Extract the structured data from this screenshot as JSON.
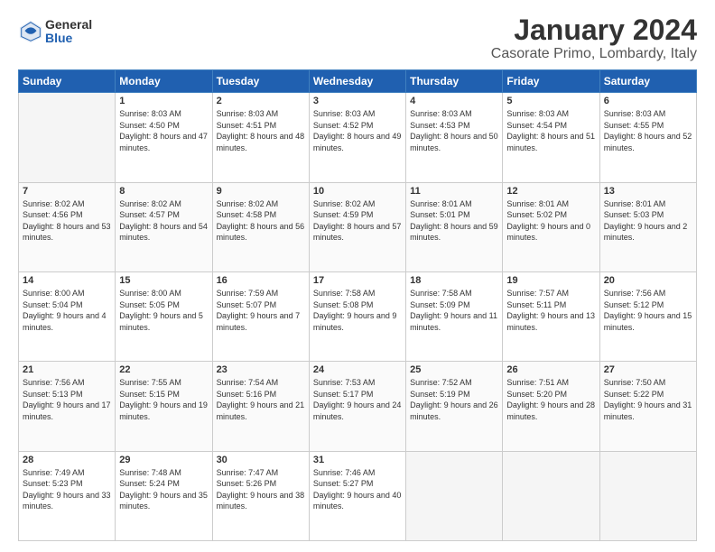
{
  "logo": {
    "general": "General",
    "blue": "Blue"
  },
  "title": "January 2024",
  "subtitle": "Casorate Primo, Lombardy, Italy",
  "headers": [
    "Sunday",
    "Monday",
    "Tuesday",
    "Wednesday",
    "Thursday",
    "Friday",
    "Saturday"
  ],
  "weeks": [
    [
      {
        "day": "",
        "empty": true
      },
      {
        "day": "1",
        "sunrise": "Sunrise: 8:03 AM",
        "sunset": "Sunset: 4:50 PM",
        "daylight": "Daylight: 8 hours and 47 minutes."
      },
      {
        "day": "2",
        "sunrise": "Sunrise: 8:03 AM",
        "sunset": "Sunset: 4:51 PM",
        "daylight": "Daylight: 8 hours and 48 minutes."
      },
      {
        "day": "3",
        "sunrise": "Sunrise: 8:03 AM",
        "sunset": "Sunset: 4:52 PM",
        "daylight": "Daylight: 8 hours and 49 minutes."
      },
      {
        "day": "4",
        "sunrise": "Sunrise: 8:03 AM",
        "sunset": "Sunset: 4:53 PM",
        "daylight": "Daylight: 8 hours and 50 minutes."
      },
      {
        "day": "5",
        "sunrise": "Sunrise: 8:03 AM",
        "sunset": "Sunset: 4:54 PM",
        "daylight": "Daylight: 8 hours and 51 minutes."
      },
      {
        "day": "6",
        "sunrise": "Sunrise: 8:03 AM",
        "sunset": "Sunset: 4:55 PM",
        "daylight": "Daylight: 8 hours and 52 minutes."
      }
    ],
    [
      {
        "day": "7",
        "sunrise": "Sunrise: 8:02 AM",
        "sunset": "Sunset: 4:56 PM",
        "daylight": "Daylight: 8 hours and 53 minutes."
      },
      {
        "day": "8",
        "sunrise": "Sunrise: 8:02 AM",
        "sunset": "Sunset: 4:57 PM",
        "daylight": "Daylight: 8 hours and 54 minutes."
      },
      {
        "day": "9",
        "sunrise": "Sunrise: 8:02 AM",
        "sunset": "Sunset: 4:58 PM",
        "daylight": "Daylight: 8 hours and 56 minutes."
      },
      {
        "day": "10",
        "sunrise": "Sunrise: 8:02 AM",
        "sunset": "Sunset: 4:59 PM",
        "daylight": "Daylight: 8 hours and 57 minutes."
      },
      {
        "day": "11",
        "sunrise": "Sunrise: 8:01 AM",
        "sunset": "Sunset: 5:01 PM",
        "daylight": "Daylight: 8 hours and 59 minutes."
      },
      {
        "day": "12",
        "sunrise": "Sunrise: 8:01 AM",
        "sunset": "Sunset: 5:02 PM",
        "daylight": "Daylight: 9 hours and 0 minutes."
      },
      {
        "day": "13",
        "sunrise": "Sunrise: 8:01 AM",
        "sunset": "Sunset: 5:03 PM",
        "daylight": "Daylight: 9 hours and 2 minutes."
      }
    ],
    [
      {
        "day": "14",
        "sunrise": "Sunrise: 8:00 AM",
        "sunset": "Sunset: 5:04 PM",
        "daylight": "Daylight: 9 hours and 4 minutes."
      },
      {
        "day": "15",
        "sunrise": "Sunrise: 8:00 AM",
        "sunset": "Sunset: 5:05 PM",
        "daylight": "Daylight: 9 hours and 5 minutes."
      },
      {
        "day": "16",
        "sunrise": "Sunrise: 7:59 AM",
        "sunset": "Sunset: 5:07 PM",
        "daylight": "Daylight: 9 hours and 7 minutes."
      },
      {
        "day": "17",
        "sunrise": "Sunrise: 7:58 AM",
        "sunset": "Sunset: 5:08 PM",
        "daylight": "Daylight: 9 hours and 9 minutes."
      },
      {
        "day": "18",
        "sunrise": "Sunrise: 7:58 AM",
        "sunset": "Sunset: 5:09 PM",
        "daylight": "Daylight: 9 hours and 11 minutes."
      },
      {
        "day": "19",
        "sunrise": "Sunrise: 7:57 AM",
        "sunset": "Sunset: 5:11 PM",
        "daylight": "Daylight: 9 hours and 13 minutes."
      },
      {
        "day": "20",
        "sunrise": "Sunrise: 7:56 AM",
        "sunset": "Sunset: 5:12 PM",
        "daylight": "Daylight: 9 hours and 15 minutes."
      }
    ],
    [
      {
        "day": "21",
        "sunrise": "Sunrise: 7:56 AM",
        "sunset": "Sunset: 5:13 PM",
        "daylight": "Daylight: 9 hours and 17 minutes."
      },
      {
        "day": "22",
        "sunrise": "Sunrise: 7:55 AM",
        "sunset": "Sunset: 5:15 PM",
        "daylight": "Daylight: 9 hours and 19 minutes."
      },
      {
        "day": "23",
        "sunrise": "Sunrise: 7:54 AM",
        "sunset": "Sunset: 5:16 PM",
        "daylight": "Daylight: 9 hours and 21 minutes."
      },
      {
        "day": "24",
        "sunrise": "Sunrise: 7:53 AM",
        "sunset": "Sunset: 5:17 PM",
        "daylight": "Daylight: 9 hours and 24 minutes."
      },
      {
        "day": "25",
        "sunrise": "Sunrise: 7:52 AM",
        "sunset": "Sunset: 5:19 PM",
        "daylight": "Daylight: 9 hours and 26 minutes."
      },
      {
        "day": "26",
        "sunrise": "Sunrise: 7:51 AM",
        "sunset": "Sunset: 5:20 PM",
        "daylight": "Daylight: 9 hours and 28 minutes."
      },
      {
        "day": "27",
        "sunrise": "Sunrise: 7:50 AM",
        "sunset": "Sunset: 5:22 PM",
        "daylight": "Daylight: 9 hours and 31 minutes."
      }
    ],
    [
      {
        "day": "28",
        "sunrise": "Sunrise: 7:49 AM",
        "sunset": "Sunset: 5:23 PM",
        "daylight": "Daylight: 9 hours and 33 minutes."
      },
      {
        "day": "29",
        "sunrise": "Sunrise: 7:48 AM",
        "sunset": "Sunset: 5:24 PM",
        "daylight": "Daylight: 9 hours and 35 minutes."
      },
      {
        "day": "30",
        "sunrise": "Sunrise: 7:47 AM",
        "sunset": "Sunset: 5:26 PM",
        "daylight": "Daylight: 9 hours and 38 minutes."
      },
      {
        "day": "31",
        "sunrise": "Sunrise: 7:46 AM",
        "sunset": "Sunset: 5:27 PM",
        "daylight": "Daylight: 9 hours and 40 minutes."
      },
      {
        "day": "",
        "empty": true
      },
      {
        "day": "",
        "empty": true
      },
      {
        "day": "",
        "empty": true
      }
    ]
  ]
}
